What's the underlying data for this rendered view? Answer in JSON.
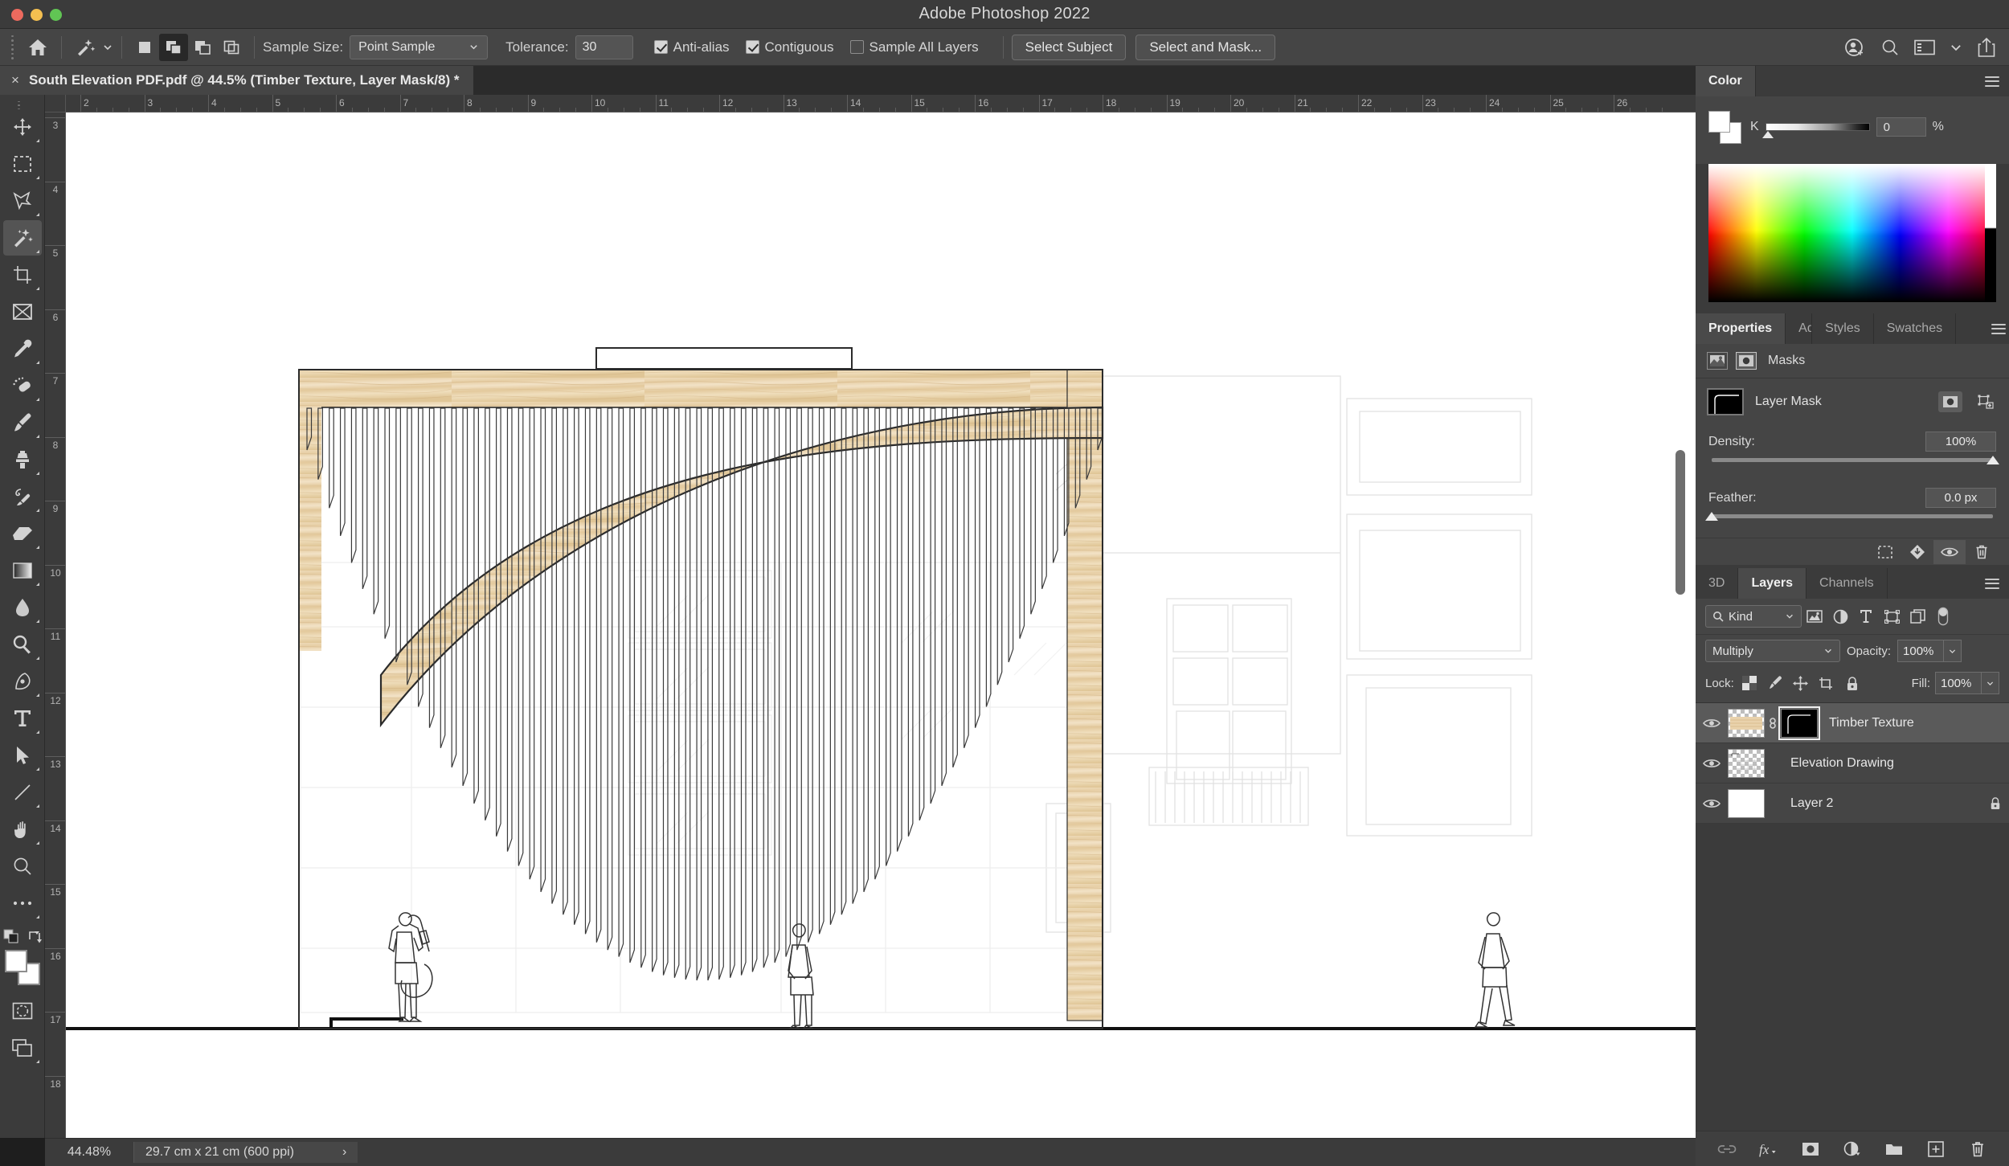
{
  "window": {
    "app_title": "Adobe Photoshop 2022",
    "traffic_lights": [
      "close",
      "minimize",
      "maximize"
    ]
  },
  "options_bar": {
    "home_icon": "home-icon",
    "tool_preset_icon": "magic-wand-icon",
    "selection_modes": [
      {
        "name": "new-selection",
        "active": false
      },
      {
        "name": "add-to-selection",
        "active": true
      },
      {
        "name": "subtract-from-selection",
        "active": false
      },
      {
        "name": "intersect-selection",
        "active": false
      }
    ],
    "sample_size_label": "Sample Size:",
    "sample_size_value": "Point Sample",
    "tolerance_label": "Tolerance:",
    "tolerance_value": "30",
    "checkboxes": [
      {
        "label": "Anti-alias",
        "checked": true
      },
      {
        "label": "Contiguous",
        "checked": true
      },
      {
        "label": "Sample All Layers",
        "checked": false
      }
    ],
    "select_subject_label": "Select Subject",
    "select_and_mask_label": "Select and Mask...",
    "right_icons": [
      "add-user-icon",
      "search-icon",
      "workspace-icon",
      "chevron-down-icon",
      "share-icon"
    ]
  },
  "document_tab": {
    "close_glyph": "×",
    "title": "South Elevation PDF.pdf @ 44.5% (Timber Texture, Layer Mask/8) *",
    "overflow_glyph": "»"
  },
  "toolbar": {
    "tools": [
      {
        "name": "move-tool",
        "icon": "move-icon",
        "active": false,
        "has_flyout": true
      },
      {
        "name": "rectangular-marquee-tool",
        "icon": "marquee-icon",
        "active": false,
        "has_flyout": true
      },
      {
        "name": "lasso-tool",
        "icon": "lasso-icon",
        "active": false,
        "has_flyout": true
      },
      {
        "name": "magic-wand-tool",
        "icon": "magic-wand-icon",
        "active": true,
        "has_flyout": true
      },
      {
        "name": "crop-tool",
        "icon": "crop-icon",
        "active": false,
        "has_flyout": true
      },
      {
        "name": "frame-tool",
        "icon": "frame-icon",
        "active": false,
        "has_flyout": false
      },
      {
        "name": "eyedropper-tool",
        "icon": "eyedropper-icon",
        "active": false,
        "has_flyout": true
      },
      {
        "name": "spot-healing-brush-tool",
        "icon": "healing-brush-icon",
        "active": false,
        "has_flyout": true
      },
      {
        "name": "brush-tool",
        "icon": "brush-icon",
        "active": false,
        "has_flyout": true
      },
      {
        "name": "clone-stamp-tool",
        "icon": "clone-stamp-icon",
        "active": false,
        "has_flyout": true
      },
      {
        "name": "history-brush-tool",
        "icon": "history-brush-icon",
        "active": false,
        "has_flyout": true
      },
      {
        "name": "eraser-tool",
        "icon": "eraser-icon",
        "active": false,
        "has_flyout": true
      },
      {
        "name": "gradient-tool",
        "icon": "gradient-icon",
        "active": false,
        "has_flyout": true
      },
      {
        "name": "blur-tool",
        "icon": "blur-icon",
        "active": false,
        "has_flyout": true
      },
      {
        "name": "dodge-tool",
        "icon": "dodge-icon",
        "active": false,
        "has_flyout": true
      },
      {
        "name": "pen-tool",
        "icon": "pen-icon",
        "active": false,
        "has_flyout": true
      },
      {
        "name": "type-tool",
        "icon": "type-icon",
        "active": false,
        "has_flyout": true
      },
      {
        "name": "path-selection-tool",
        "icon": "path-arrow-icon",
        "active": false,
        "has_flyout": true
      },
      {
        "name": "line-shape-tool",
        "icon": "line-icon",
        "active": false,
        "has_flyout": true
      },
      {
        "name": "hand-tool",
        "icon": "hand-icon",
        "active": false,
        "has_flyout": true
      },
      {
        "name": "zoom-tool",
        "icon": "zoom-icon",
        "active": false,
        "has_flyout": false
      },
      {
        "name": "edit-toolbar",
        "icon": "ellipsis-icon",
        "active": false,
        "has_flyout": true
      }
    ],
    "default_colors_icon": "default-colors-icon",
    "swap_colors_icon": "swap-colors-icon",
    "foreground_color": "#ffffff",
    "background_color": "#ffffff",
    "quick_mask_icon": "quick-mask-icon",
    "screen_mode_icon": "screen-mode-icon"
  },
  "rulers": {
    "unit": "cm",
    "horizontal_ticks": [
      2,
      3,
      4,
      5,
      6,
      7,
      8,
      9,
      10,
      11,
      12,
      13,
      14,
      15,
      16,
      17,
      18,
      19,
      20,
      21,
      22,
      23,
      24,
      25,
      26
    ],
    "vertical_ticks": [
      3,
      4,
      5,
      6,
      7,
      8,
      9,
      10,
      11,
      12,
      13,
      14,
      15,
      16,
      17,
      18
    ]
  },
  "canvas": {
    "description": "South elevation architectural drawing with timber texture arch",
    "timber_color": "#e8d3ae",
    "line_color": "#2b2b2b",
    "ghost_line_color": "#e0e0e0",
    "figures": [
      "person-with-bicycle",
      "person-standing",
      "person-walking"
    ]
  },
  "status_bar": {
    "zoom_level": "44.48%",
    "doc_dimensions": "29.7 cm x 21 cm (600 ppi)",
    "expand_glyph": "›"
  },
  "color_panel": {
    "tab_label": "Color",
    "menu_icon": "panel-menu-icon",
    "foreground_swatch": "#ffffff",
    "background_swatch": "#ffffff",
    "channel_label": "K",
    "channel_value": "0",
    "percent_symbol": "%"
  },
  "properties_panel": {
    "tabs": [
      {
        "label": "Properties",
        "active": true
      },
      {
        "label": "Adjustme",
        "active": false
      },
      {
        "label": "Styles",
        "active": false
      },
      {
        "label": "Swatches",
        "active": false
      }
    ],
    "menu_icon": "panel-menu-icon",
    "section_label": "Masks",
    "pixel_mask_icon": "pixel-mask-icon",
    "vector_mask_icon": "vector-mask-icon",
    "mask_name": "Layer Mask",
    "select_mask_icon": "select-mask-icon",
    "add_vector_mask_icon": "add-vector-mask-icon",
    "density_label": "Density:",
    "density_value": "100%",
    "density_pct": 100,
    "feather_label": "Feather:",
    "feather_value": "0.0 px",
    "feather_pct": 0,
    "footer_icons": [
      "load-selection-icon",
      "apply-mask-icon",
      "toggle-mask-icon",
      "delete-mask-icon"
    ]
  },
  "layers_panel": {
    "tabs": [
      {
        "label": "3D",
        "active": false
      },
      {
        "label": "Layers",
        "active": true
      },
      {
        "label": "Channels",
        "active": false
      }
    ],
    "menu_icon": "panel-menu-icon",
    "filter_label": "Kind",
    "filter_search_icon": "search-icon",
    "filter_icons": [
      "pixel-filter-icon",
      "adjustment-filter-icon",
      "type-filter-icon",
      "shape-filter-icon",
      "smart-object-filter-icon"
    ],
    "filter_toggle": "filter-toggle-switch",
    "blend_mode": "Multiply",
    "opacity_label": "Opacity:",
    "opacity_value": "100%",
    "lock_label": "Lock:",
    "lock_icons": [
      "lock-transparency-icon",
      "lock-image-icon",
      "lock-position-icon",
      "lock-artboard-icon",
      "lock-all-icon"
    ],
    "fill_label": "Fill:",
    "fill_value": "100%",
    "layers": [
      {
        "name": "Timber Texture",
        "visible": true,
        "selected": true,
        "thumb_type": "timber",
        "has_mask": true,
        "mask_linked": true,
        "mask_active": true,
        "locked": false
      },
      {
        "name": "Elevation Drawing",
        "visible": true,
        "selected": false,
        "thumb_type": "drawing",
        "has_mask": false,
        "mask_linked": false,
        "mask_active": false,
        "locked": false
      },
      {
        "name": "Layer 2",
        "visible": true,
        "selected": false,
        "thumb_type": "white",
        "has_mask": false,
        "mask_linked": false,
        "mask_active": false,
        "locked": true
      }
    ],
    "footer_icons": [
      "link-layers-icon",
      "layer-style-fx-icon",
      "add-mask-icon",
      "adjustment-layer-icon",
      "new-group-icon",
      "new-layer-icon",
      "delete-layer-icon"
    ]
  }
}
